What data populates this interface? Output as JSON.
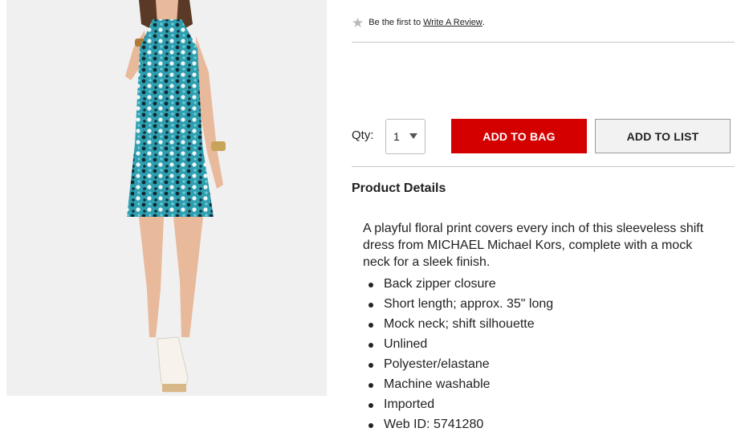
{
  "review": {
    "prefix": "Be the first to",
    "link": "Write A Review",
    "suffix": "."
  },
  "purchase": {
    "qty_label": "Qty:",
    "qty_value": "1",
    "add_to_bag": "ADD TO BAG",
    "add_to_list": "ADD TO LIST"
  },
  "details": {
    "heading": "Product Details",
    "description": "A playful floral print covers every inch of this sleeveless shift dress from MICHAEL Michael Kors, complete with a mock neck for a sleek finish.",
    "bullets": [
      "Back zipper closure",
      "Short length; approx. 35\" long",
      "Mock neck; shift silhouette",
      "Unlined",
      "Polyester/elastane",
      "Machine washable",
      "Imported",
      "Web ID: 5741280"
    ]
  },
  "colors": {
    "primary_button": "#d40000",
    "secondary_button": "#f2f2f2",
    "star_empty": "#b8b8b8"
  },
  "icons": {
    "star": "empty-star-icon",
    "qty_caret": "caret-down-icon"
  }
}
